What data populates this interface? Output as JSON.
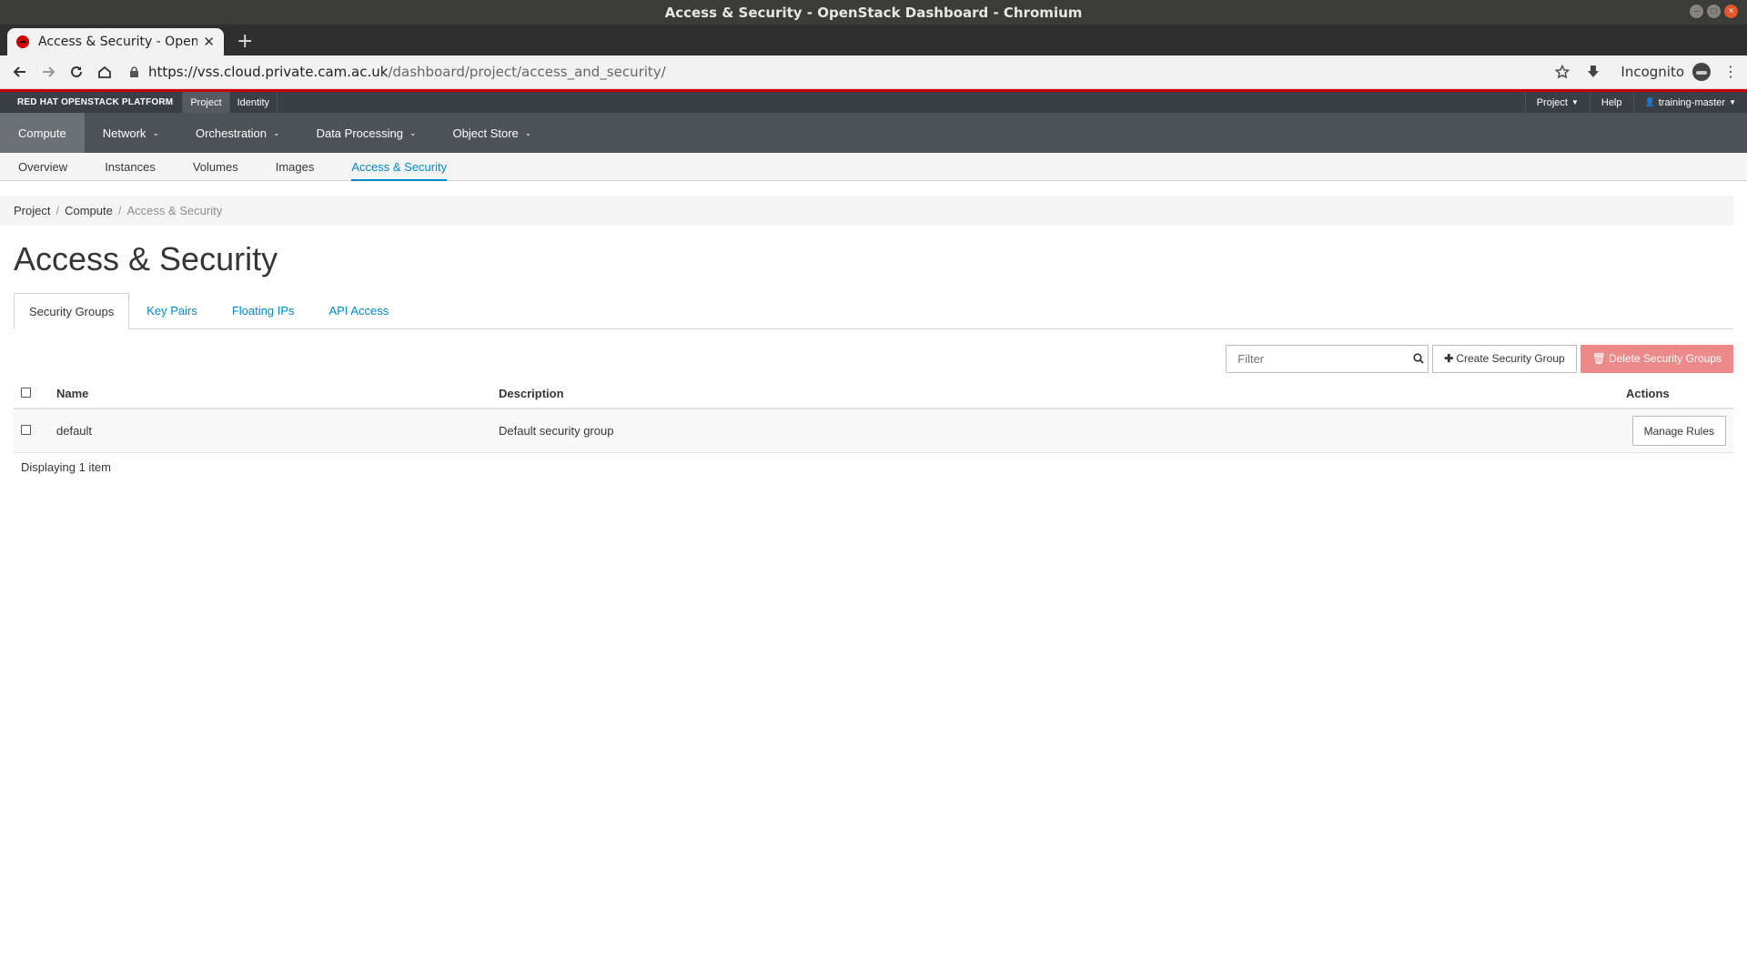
{
  "window": {
    "title": "Access & Security - OpenStack Dashboard - Chromium"
  },
  "browser": {
    "tab_title": "Access & Security - OpenStack Dashboard",
    "url_host": "https://vss.cloud.private.cam.ac.uk",
    "url_path": "/dashboard/project/access_and_security/",
    "incognito_label": "Incognito"
  },
  "topbar": {
    "brand": "RED HAT OPENSTACK PLATFORM",
    "items": [
      {
        "label": "Project",
        "active": true
      },
      {
        "label": "Identity",
        "active": false
      }
    ],
    "right": {
      "project_menu": "Project",
      "help": "Help",
      "user": "training-master"
    }
  },
  "primary_nav": [
    {
      "label": "Compute",
      "active": true,
      "dropdown": false
    },
    {
      "label": "Network",
      "active": false,
      "dropdown": true
    },
    {
      "label": "Orchestration",
      "active": false,
      "dropdown": true
    },
    {
      "label": "Data Processing",
      "active": false,
      "dropdown": true
    },
    {
      "label": "Object Store",
      "active": false,
      "dropdown": true
    }
  ],
  "secondary_nav": [
    {
      "label": "Overview",
      "active": false
    },
    {
      "label": "Instances",
      "active": false
    },
    {
      "label": "Volumes",
      "active": false
    },
    {
      "label": "Images",
      "active": false
    },
    {
      "label": "Access & Security",
      "active": true
    }
  ],
  "breadcrumb": [
    "Project",
    "Compute",
    "Access & Security"
  ],
  "page_title": "Access & Security",
  "tabs": [
    {
      "label": "Security Groups",
      "active": true
    },
    {
      "label": "Key Pairs",
      "active": false
    },
    {
      "label": "Floating IPs",
      "active": false
    },
    {
      "label": "API Access",
      "active": false
    }
  ],
  "table": {
    "filter_placeholder": "Filter",
    "create_button": "Create Security Group",
    "delete_button": "Delete Security Groups",
    "columns": [
      "Name",
      "Description",
      "Actions"
    ],
    "rows": [
      {
        "name": "default",
        "description": "Default security group",
        "action": "Manage Rules"
      }
    ],
    "footer": "Displaying 1 item"
  },
  "colors": {
    "accent": "#0088ce",
    "brand_red": "#cc0000",
    "danger": "#ec8a8a"
  }
}
